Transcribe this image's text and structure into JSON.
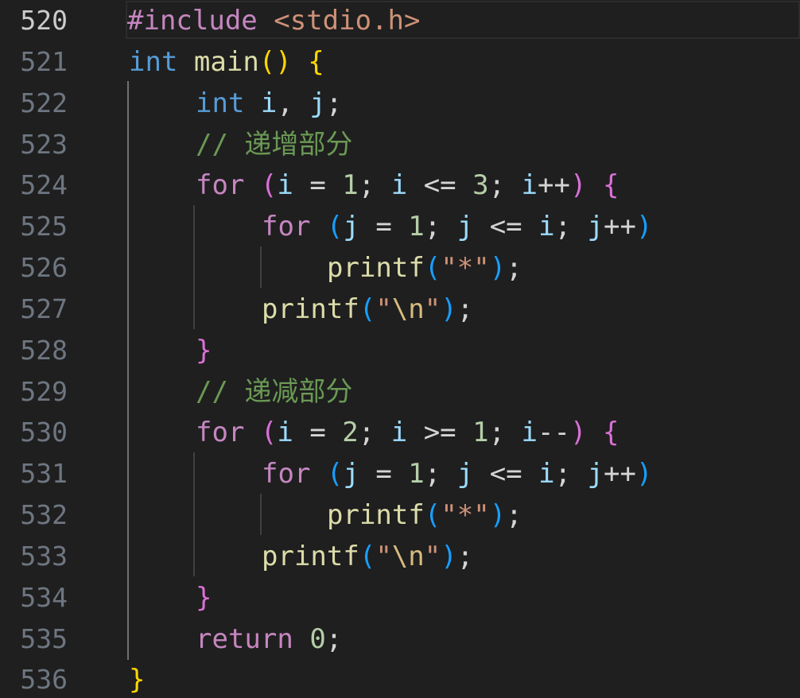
{
  "editor": {
    "language": "c",
    "current_line": "520",
    "colors": {
      "background": "#1f1f1f",
      "line_number": "#6e7681",
      "line_number_active": "#cccccc",
      "keyword": "#c586c0",
      "type": "#569cd6",
      "function": "#dcdcaa",
      "variable": "#9cdcfe",
      "number": "#b5cea8",
      "string": "#ce9178",
      "comment": "#6a9955",
      "bracket_level_1": "#ffd700",
      "bracket_level_2": "#da70d6",
      "bracket_level_3": "#179fff"
    },
    "lines": [
      {
        "number": "520",
        "tokens": [
          {
            "t": "#include ",
            "k": "keyword"
          },
          {
            "t": "<stdio.h>",
            "k": "string"
          }
        ]
      },
      {
        "number": "521",
        "tokens": [
          {
            "t": "int",
            "k": "type"
          },
          {
            "t": " ",
            "k": "plain"
          },
          {
            "t": "main",
            "k": "function"
          },
          {
            "t": "()",
            "k": "brace1"
          },
          {
            "t": " ",
            "k": "plain"
          },
          {
            "t": "{",
            "k": "brace1"
          }
        ]
      },
      {
        "number": "522",
        "tokens": [
          {
            "t": "int",
            "k": "type"
          },
          {
            "t": " ",
            "k": "plain"
          },
          {
            "t": "i",
            "k": "variable"
          },
          {
            "t": ", ",
            "k": "plain"
          },
          {
            "t": "j",
            "k": "variable"
          },
          {
            "t": ";",
            "k": "plain"
          }
        ]
      },
      {
        "number": "523",
        "tokens": [
          {
            "t": "// 递增部分",
            "k": "comment"
          }
        ]
      },
      {
        "number": "524",
        "tokens": [
          {
            "t": "for",
            "k": "keyword"
          },
          {
            "t": " ",
            "k": "plain"
          },
          {
            "t": "(",
            "k": "brace2"
          },
          {
            "t": "i",
            "k": "variable"
          },
          {
            "t": " = ",
            "k": "operator"
          },
          {
            "t": "1",
            "k": "number"
          },
          {
            "t": "; ",
            "k": "plain"
          },
          {
            "t": "i",
            "k": "variable"
          },
          {
            "t": " <= ",
            "k": "operator"
          },
          {
            "t": "3",
            "k": "number"
          },
          {
            "t": "; ",
            "k": "plain"
          },
          {
            "t": "i",
            "k": "variable"
          },
          {
            "t": "++",
            "k": "operator"
          },
          {
            "t": ")",
            "k": "brace2"
          },
          {
            "t": " ",
            "k": "plain"
          },
          {
            "t": "{",
            "k": "brace2"
          }
        ]
      },
      {
        "number": "525",
        "tokens": [
          {
            "t": "for",
            "k": "keyword"
          },
          {
            "t": " ",
            "k": "plain"
          },
          {
            "t": "(",
            "k": "brace3"
          },
          {
            "t": "j",
            "k": "variable"
          },
          {
            "t": " = ",
            "k": "operator"
          },
          {
            "t": "1",
            "k": "number"
          },
          {
            "t": "; ",
            "k": "plain"
          },
          {
            "t": "j",
            "k": "variable"
          },
          {
            "t": " <= ",
            "k": "operator"
          },
          {
            "t": "i",
            "k": "variable"
          },
          {
            "t": "; ",
            "k": "plain"
          },
          {
            "t": "j",
            "k": "variable"
          },
          {
            "t": "++",
            "k": "operator"
          },
          {
            "t": ")",
            "k": "brace3"
          }
        ]
      },
      {
        "number": "526",
        "tokens": [
          {
            "t": "printf",
            "k": "function"
          },
          {
            "t": "(",
            "k": "brace3"
          },
          {
            "t": "\"*\"",
            "k": "string"
          },
          {
            "t": ")",
            "k": "brace3"
          },
          {
            "t": ";",
            "k": "plain"
          }
        ]
      },
      {
        "number": "527",
        "tokens": [
          {
            "t": "printf",
            "k": "function"
          },
          {
            "t": "(",
            "k": "brace3"
          },
          {
            "t": "\"",
            "k": "string"
          },
          {
            "t": "\\n",
            "k": "escape"
          },
          {
            "t": "\"",
            "k": "string"
          },
          {
            "t": ")",
            "k": "brace3"
          },
          {
            "t": ";",
            "k": "plain"
          }
        ]
      },
      {
        "number": "528",
        "tokens": [
          {
            "t": "}",
            "k": "brace2"
          }
        ]
      },
      {
        "number": "529",
        "tokens": [
          {
            "t": "// 递减部分",
            "k": "comment"
          }
        ]
      },
      {
        "number": "530",
        "tokens": [
          {
            "t": "for",
            "k": "keyword"
          },
          {
            "t": " ",
            "k": "plain"
          },
          {
            "t": "(",
            "k": "brace2"
          },
          {
            "t": "i",
            "k": "variable"
          },
          {
            "t": " = ",
            "k": "operator"
          },
          {
            "t": "2",
            "k": "number"
          },
          {
            "t": "; ",
            "k": "plain"
          },
          {
            "t": "i",
            "k": "variable"
          },
          {
            "t": " >= ",
            "k": "operator"
          },
          {
            "t": "1",
            "k": "number"
          },
          {
            "t": "; ",
            "k": "plain"
          },
          {
            "t": "i",
            "k": "variable"
          },
          {
            "t": "--",
            "k": "operator"
          },
          {
            "t": ")",
            "k": "brace2"
          },
          {
            "t": " ",
            "k": "plain"
          },
          {
            "t": "{",
            "k": "brace2"
          }
        ]
      },
      {
        "number": "531",
        "tokens": [
          {
            "t": "for",
            "k": "keyword"
          },
          {
            "t": " ",
            "k": "plain"
          },
          {
            "t": "(",
            "k": "brace3"
          },
          {
            "t": "j",
            "k": "variable"
          },
          {
            "t": " = ",
            "k": "operator"
          },
          {
            "t": "1",
            "k": "number"
          },
          {
            "t": "; ",
            "k": "plain"
          },
          {
            "t": "j",
            "k": "variable"
          },
          {
            "t": " <= ",
            "k": "operator"
          },
          {
            "t": "i",
            "k": "variable"
          },
          {
            "t": "; ",
            "k": "plain"
          },
          {
            "t": "j",
            "k": "variable"
          },
          {
            "t": "++",
            "k": "operator"
          },
          {
            "t": ")",
            "k": "brace3"
          }
        ]
      },
      {
        "number": "532",
        "tokens": [
          {
            "t": "printf",
            "k": "function"
          },
          {
            "t": "(",
            "k": "brace3"
          },
          {
            "t": "\"*\"",
            "k": "string"
          },
          {
            "t": ")",
            "k": "brace3"
          },
          {
            "t": ";",
            "k": "plain"
          }
        ]
      },
      {
        "number": "533",
        "tokens": [
          {
            "t": "printf",
            "k": "function"
          },
          {
            "t": "(",
            "k": "brace3"
          },
          {
            "t": "\"",
            "k": "string"
          },
          {
            "t": "\\n",
            "k": "escape"
          },
          {
            "t": "\"",
            "k": "string"
          },
          {
            "t": ")",
            "k": "brace3"
          },
          {
            "t": ";",
            "k": "plain"
          }
        ]
      },
      {
        "number": "534",
        "tokens": [
          {
            "t": "}",
            "k": "brace2"
          }
        ]
      },
      {
        "number": "535",
        "tokens": [
          {
            "t": "return",
            "k": "keyword"
          },
          {
            "t": " ",
            "k": "plain"
          },
          {
            "t": "0",
            "k": "number"
          },
          {
            "t": ";",
            "k": "plain"
          }
        ]
      },
      {
        "number": "536",
        "tokens": [
          {
            "t": "}",
            "k": "brace1"
          }
        ]
      }
    ]
  }
}
